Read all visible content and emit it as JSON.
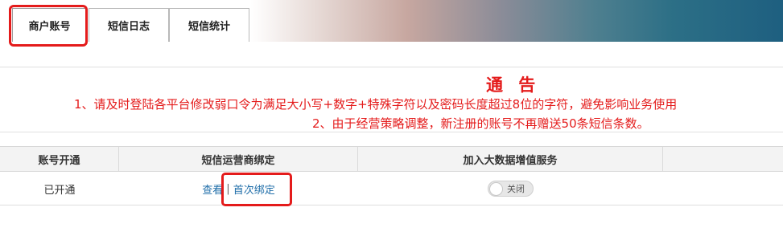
{
  "tabs": [
    {
      "label": "商户账号"
    },
    {
      "label": "短信日志"
    },
    {
      "label": "短信统计"
    }
  ],
  "notice": {
    "title": "通 告",
    "lines": [
      "1、请及时登陆各平台修改弱口令为满足大小写+数字+特殊字符以及密码长度超过8位的字符，避免影响业务使用",
      "2、由于经营策略调整，新注册的账号不再赠送50条短信条数。"
    ]
  },
  "table": {
    "headers": [
      "账号开通",
      "短信运营商绑定",
      "加入大数据增值服务"
    ],
    "row": {
      "account_status": "已开通",
      "view_label": "查看",
      "separator": "|",
      "bind_label": "首次绑定",
      "toggle_label": "关闭"
    }
  },
  "colors": {
    "accent_red": "#e41b1b",
    "link_blue": "#1f6ea9"
  }
}
